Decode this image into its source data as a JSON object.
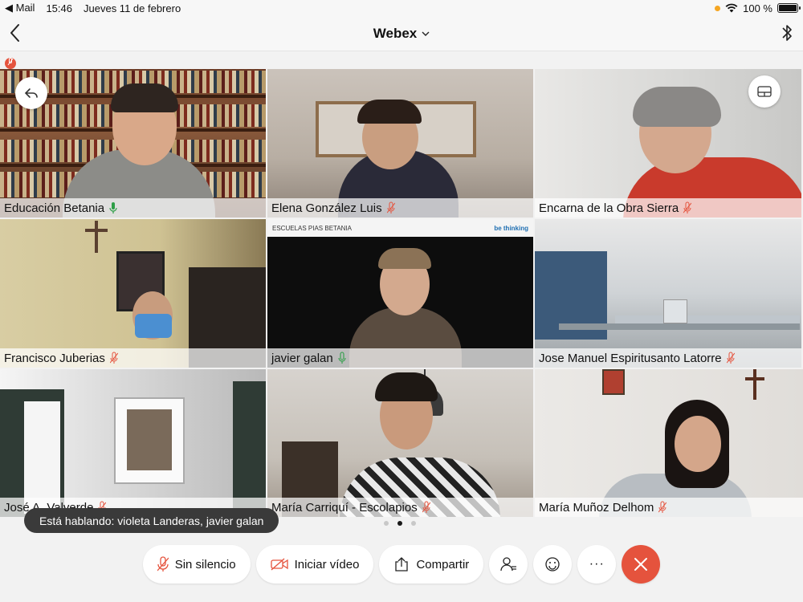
{
  "status_bar": {
    "back_app": "◀ Mail",
    "time": "15:46",
    "date": "Jueves 11 de febrero",
    "battery": "100 %",
    "battery_level": 1.0
  },
  "nav": {
    "title": "Webex",
    "title_chevron": "⌄"
  },
  "participants": [
    {
      "name": "Educación Betania",
      "mic": "active"
    },
    {
      "name": "Elena González Luis",
      "mic": "muted"
    },
    {
      "name": "Encarna de la Obra Sierra",
      "mic": "muted"
    },
    {
      "name": "Francisco Juberias",
      "mic": "muted"
    },
    {
      "name": "javier galan",
      "mic": "active"
    },
    {
      "name": "Jose Manuel Espiritusanto Latorre",
      "mic": "muted"
    },
    {
      "name": "José A. Valverde",
      "mic": "muted"
    },
    {
      "name": "María Carriquí - Escolapios",
      "mic": "muted"
    },
    {
      "name": "María Muñoz Delhom",
      "mic": "muted"
    }
  ],
  "tile5_banner": {
    "left_text": "ESCUELAS PIAS BETANIA",
    "right_text": "be thinking"
  },
  "speaking_toast": "Está hablando: violeta Landeras, javier galan",
  "pager": {
    "pages": 3,
    "current": 2
  },
  "controls": {
    "unmute_label": "Sin silencio",
    "video_label": "Iniciar vídeo",
    "share_label": "Compartir",
    "participants_icon": "participants-icon",
    "reactions_icon": "emoji-icon",
    "more_label": "···",
    "end_icon": "close-icon"
  },
  "colors": {
    "mic_active": "#2e9e47",
    "mic_muted": "#e5533d",
    "end_call": "#e5533d"
  }
}
